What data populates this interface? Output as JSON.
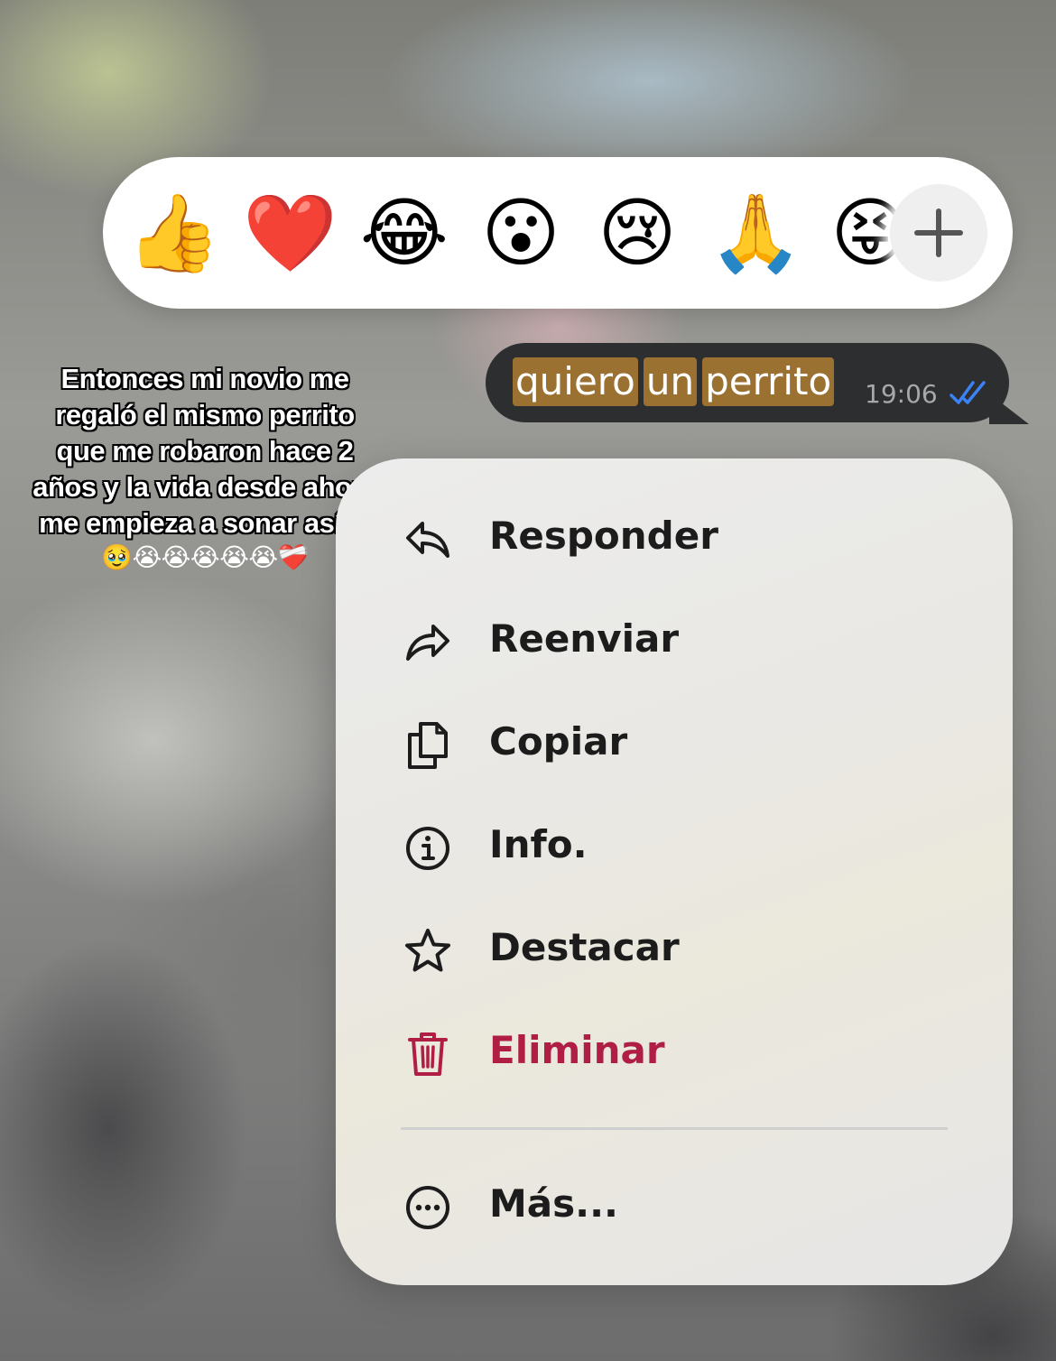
{
  "reactions": {
    "items": [
      "👍",
      "❤️",
      "😂",
      "😮",
      "😢",
      "🙏",
      "😝"
    ],
    "add_label": "+"
  },
  "caption": {
    "lines": [
      "Entonces mi novio me",
      "regaló el mismo perrito",
      "que me robaron hace 2",
      "años y la vida desde ahora",
      "me empieza a sonar así ..."
    ],
    "emoji": "🥹😭😭😭😭😭❤️‍🩹"
  },
  "message": {
    "words": [
      "quiero",
      "un",
      "perrito"
    ],
    "time": "19:06",
    "status": "read"
  },
  "menu": {
    "items": [
      {
        "label": "Responder",
        "icon": "reply-icon"
      },
      {
        "label": "Reenviar",
        "icon": "forward-icon"
      },
      {
        "label": "Copiar",
        "icon": "copy-icon"
      },
      {
        "label": "Info.",
        "icon": "info-icon"
      },
      {
        "label": "Destacar",
        "icon": "star-icon"
      },
      {
        "label": "Eliminar",
        "icon": "trash-icon"
      },
      {
        "label": "Más...",
        "icon": "more-icon"
      }
    ]
  },
  "colors": {
    "danger": "#b01e46",
    "highlight": "#9b7132",
    "bubble": "#2d2e30",
    "read_ticks": "#3b82f6"
  }
}
